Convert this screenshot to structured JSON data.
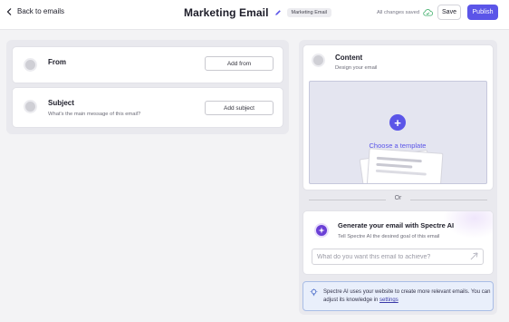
{
  "header": {
    "back_label": "Back to emails",
    "title": "Marketing Email",
    "chip": "Marketing Email",
    "saved_status": "All changes saved",
    "save_label": "Save",
    "publish_label": "Publish"
  },
  "colors": {
    "accent": "#5b55e8",
    "ai_purple": "#6a3fd6",
    "saved_green": "#3fae6a"
  },
  "left": {
    "from": {
      "label": "From",
      "button": "Add from"
    },
    "subject": {
      "label": "Subject",
      "description": "What's the main message of this email?",
      "button": "Add subject"
    }
  },
  "content": {
    "title": "Content",
    "subtitle": "Design your email",
    "choose_label": "Choose a template"
  },
  "divider": {
    "label": "Or"
  },
  "ai": {
    "title": "Generate your email with Spectre AI",
    "subtitle": "Tell Spectre AI the desired goal of this email",
    "placeholder": "What do you want this email to achieve?"
  },
  "info": {
    "text": "Spectre AI uses your website to create more relevant emails. You can adjust its knowledge in",
    "link": "settings"
  },
  "icons": {
    "back": "chevron-left-icon",
    "edit": "pencil-icon",
    "saved": "cloud-check-icon",
    "add": "plus-icon",
    "ai": "sparkle-icon",
    "send": "send-icon",
    "info": "lightbulb-icon"
  }
}
